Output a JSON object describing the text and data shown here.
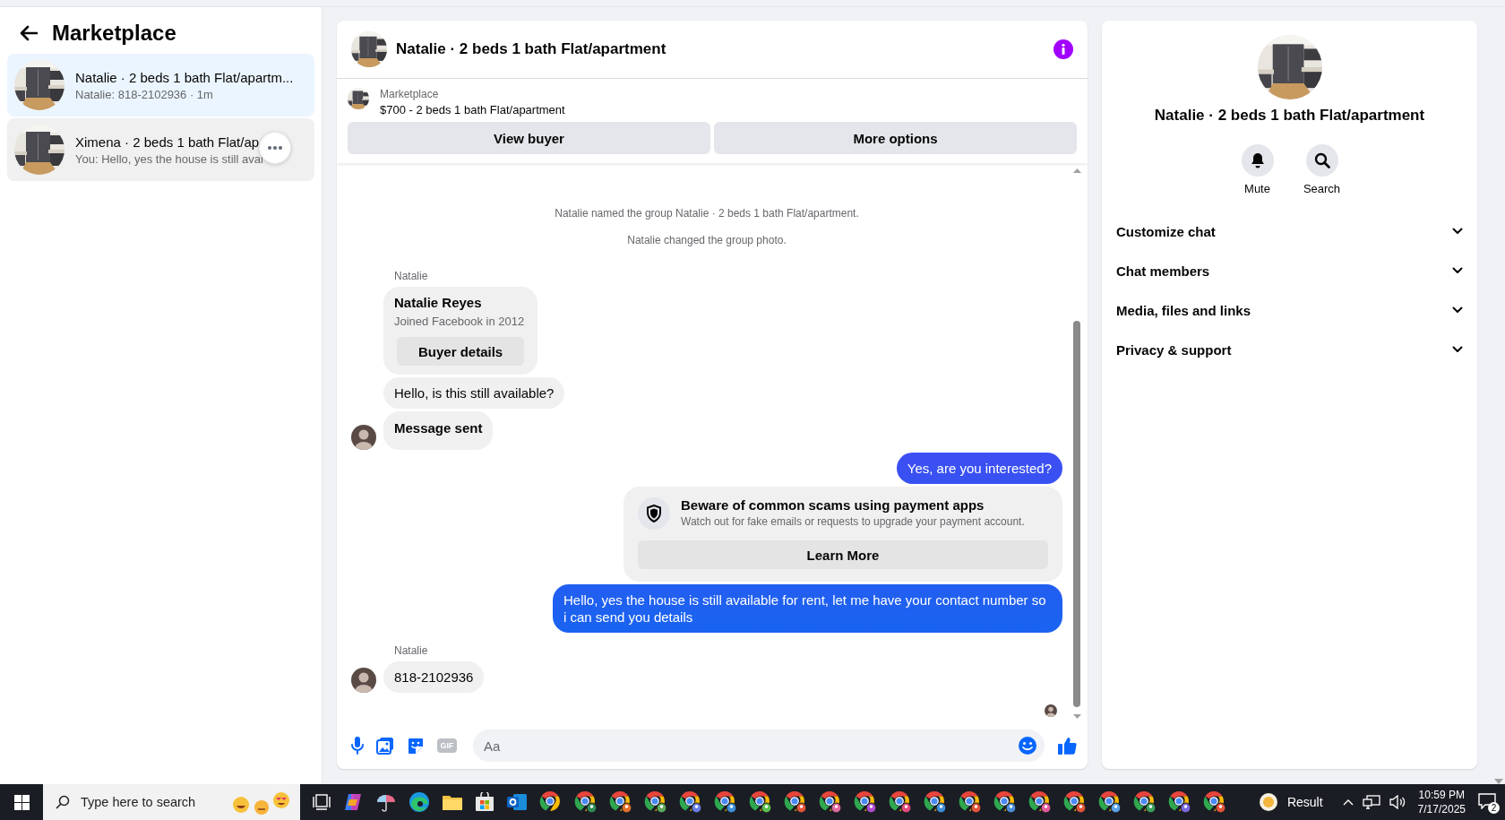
{
  "sidebar": {
    "title": "Marketplace",
    "conversations": [
      {
        "title": "Natalie · 2 beds 1 bath Flat/apartm...",
        "preview": "Natalie: 818-2102936 · 1m",
        "selected": true,
        "hovered": false
      },
      {
        "title": "Ximena · 2 beds 1 bath Flat/ap",
        "preview": "You: Hello, yes the house is still avai",
        "selected": false,
        "hovered": true
      }
    ]
  },
  "chat": {
    "title": "Natalie · 2 beds 1 bath Flat/apartment",
    "listing": {
      "source": "Marketplace",
      "summary": "$700 - 2 beds 1 bath Flat/apartment"
    },
    "actions": [
      "View buyer",
      "More options"
    ],
    "messages": [
      {
        "kind": "system",
        "text": "Natalie named the group Natalie · 2 beds 1 bath Flat/apartment."
      },
      {
        "kind": "system",
        "text": "Natalie changed the group photo."
      },
      {
        "kind": "sender",
        "text": "Natalie"
      },
      {
        "kind": "profile",
        "name": "Natalie Reyes",
        "detail": "Joined Facebook in 2012",
        "button": "Buyer details"
      },
      {
        "kind": "incoming",
        "text": "Hello, is this still available?",
        "avatar": false
      },
      {
        "kind": "notice",
        "text": "Message sent",
        "avatar": true
      },
      {
        "kind": "outgoing",
        "text": "Yes, are you interested?"
      },
      {
        "kind": "safety",
        "title": "Beware of common scams using payment apps",
        "text": "Watch out for fake emails or requests to upgrade your payment account.",
        "button": "Learn More"
      },
      {
        "kind": "outgoing",
        "text": "Hello, yes the house is still available for rent, let me have your contact number so i can send you details"
      },
      {
        "kind": "sender",
        "text": "Natalie"
      },
      {
        "kind": "incoming",
        "text": "818-2102936",
        "avatar": true
      }
    ],
    "composer": {
      "gif_label": "GIF",
      "placeholder": "Aa"
    }
  },
  "details": {
    "title": "Natalie · 2 beds 1 bath Flat/apartment",
    "actions": [
      {
        "kind": "mute",
        "label": "Mute"
      },
      {
        "kind": "search",
        "label": "Search"
      }
    ],
    "sections": [
      {
        "label": "Customize chat",
        "expanded": false
      },
      {
        "label": "Chat members",
        "expanded": false
      },
      {
        "label": "Media, files and links",
        "expanded": false
      },
      {
        "label": "Privacy & support",
        "expanded": false
      }
    ]
  },
  "taskbar": {
    "search_placeholder": "Type here to search",
    "weather": "Result",
    "time": "10:59 PM",
    "date": "7/17/2025",
    "notifications": "2"
  }
}
